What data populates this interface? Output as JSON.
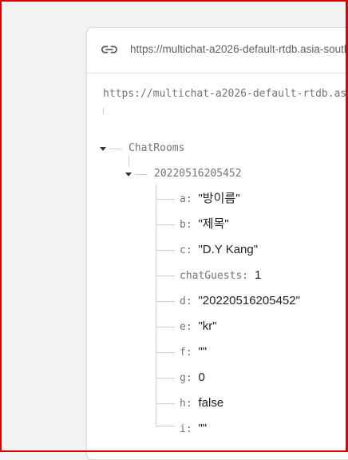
{
  "url_bar": {
    "icon": "link-icon",
    "text": "https://multichat-a2026-default-rtdb.asia-south"
  },
  "tree": {
    "root_url": "https://multichat-a2026-default-rtdb.asi",
    "level1_key": "ChatRooms",
    "level2_key": "20220516205452",
    "fields": [
      {
        "key": "a",
        "value": "\"방이름\""
      },
      {
        "key": "b",
        "value": "\"제목\""
      },
      {
        "key": "c",
        "value": "\"D.Y Kang\""
      },
      {
        "key": "chatGuests",
        "value": "1"
      },
      {
        "key": "d",
        "value": "\"20220516205452\""
      },
      {
        "key": "e",
        "value": "\"kr\""
      },
      {
        "key": "f",
        "value": "\"\""
      },
      {
        "key": "g",
        "value": "0"
      },
      {
        "key": "h",
        "value": "false"
      },
      {
        "key": "i",
        "value": "\"\""
      }
    ]
  }
}
